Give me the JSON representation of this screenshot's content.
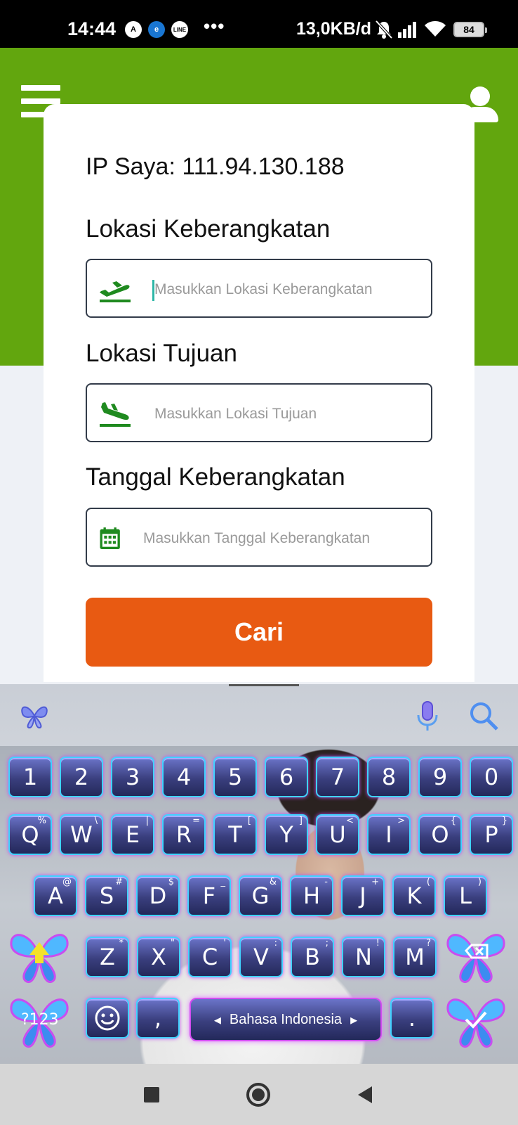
{
  "status_bar": {
    "time": "14:44",
    "network_rate": "13,0KB/d",
    "battery": "84",
    "more": "•••"
  },
  "form": {
    "ip_text": "IP Saya: 111.94.130.188",
    "departure": {
      "label": "Lokasi Keberangkatan",
      "placeholder": "Masukkan Lokasi Keberangkatan",
      "value": ""
    },
    "destination": {
      "label": "Lokasi Tujuan",
      "placeholder": "Masukkan Lokasi Tujuan",
      "value": ""
    },
    "date": {
      "label": "Tanggal Keberangkatan",
      "placeholder": "Masukkan Tanggal Keberangkatan",
      "value": ""
    },
    "search_button": "Cari"
  },
  "keyboard": {
    "row_numbers": [
      "1",
      "2",
      "3",
      "4",
      "5",
      "6",
      "7",
      "8",
      "9",
      "0"
    ],
    "row_1": [
      {
        "k": "Q",
        "alt": "%"
      },
      {
        "k": "W",
        "alt": "\\"
      },
      {
        "k": "E",
        "alt": "|"
      },
      {
        "k": "R",
        "alt": "="
      },
      {
        "k": "T",
        "alt": "["
      },
      {
        "k": "Y",
        "alt": "]"
      },
      {
        "k": "U",
        "alt": "<"
      },
      {
        "k": "I",
        "alt": ">"
      },
      {
        "k": "O",
        "alt": "{"
      },
      {
        "k": "P",
        "alt": "}"
      }
    ],
    "row_2": [
      {
        "k": "A",
        "alt": "@"
      },
      {
        "k": "S",
        "alt": "#"
      },
      {
        "k": "D",
        "alt": "$"
      },
      {
        "k": "F",
        "alt": "_"
      },
      {
        "k": "G",
        "alt": "&"
      },
      {
        "k": "H",
        "alt": "-"
      },
      {
        "k": "J",
        "alt": "+"
      },
      {
        "k": "K",
        "alt": "("
      },
      {
        "k": "L",
        "alt": ")"
      }
    ],
    "row_3": [
      {
        "k": "Z",
        "alt": "*"
      },
      {
        "k": "X",
        "alt": "\""
      },
      {
        "k": "C",
        "alt": "'"
      },
      {
        "k": "V",
        "alt": ":"
      },
      {
        "k": "B",
        "alt": ";"
      },
      {
        "k": "N",
        "alt": "!"
      },
      {
        "k": "M",
        "alt": "?"
      }
    ],
    "symbols_key": "?123",
    "comma_key": ",",
    "period_key": ".",
    "space_label": "Bahasa Indonesia",
    "space_arrow_left": "◂",
    "space_arrow_right": "▸"
  },
  "icons": {
    "menu": "hamburger-menu-icon",
    "user": "user-icon",
    "takeoff": "airplane-takeoff-icon",
    "landing": "airplane-landing-icon",
    "calendar": "calendar-icon"
  },
  "colors": {
    "header_green": "#62a60e",
    "button_orange": "#e85a12",
    "icon_green": "#1f8a1f"
  }
}
